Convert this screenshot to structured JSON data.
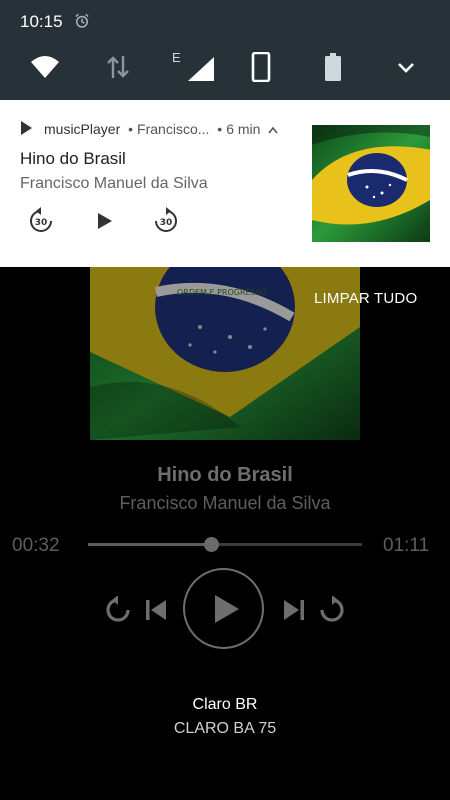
{
  "status": {
    "time": "10:15",
    "network_type": "E"
  },
  "notification": {
    "app_name": "musicPlayer",
    "sub_text": "Francisco...",
    "age": "6 min",
    "title": "Hino do Brasil",
    "text": "Francisco Manuel da Silva",
    "rewind_seconds": "30",
    "forward_seconds": "30",
    "flag_motto": "ORDEM E PROGRESSO"
  },
  "player": {
    "clear_all_label": "LIMPAR TUDO",
    "song_title": "Hino do Brasil",
    "artist": "Francisco Manuel da Silva",
    "current_time": "00:32",
    "total_time": "01:11",
    "progress": 0.45
  },
  "carrier": {
    "name": "Claro BR",
    "network": "CLARO BA 75"
  },
  "colors": {
    "quick_settings_bg": "#263238",
    "flag_green": "#1f7a2c",
    "flag_yellow": "#e8c21a",
    "flag_blue": "#1a2a6e"
  },
  "icons": [
    "alarm-icon",
    "wifi-icon",
    "data-arrows-icon",
    "signal-icon",
    "phone-rotate-icon",
    "battery-icon",
    "chevron-down-icon",
    "play-icon",
    "replay-30-icon",
    "forward-30-icon",
    "flag-art",
    "previous-icon",
    "next-icon",
    "repeat-icon",
    "shuffle-icon"
  ]
}
